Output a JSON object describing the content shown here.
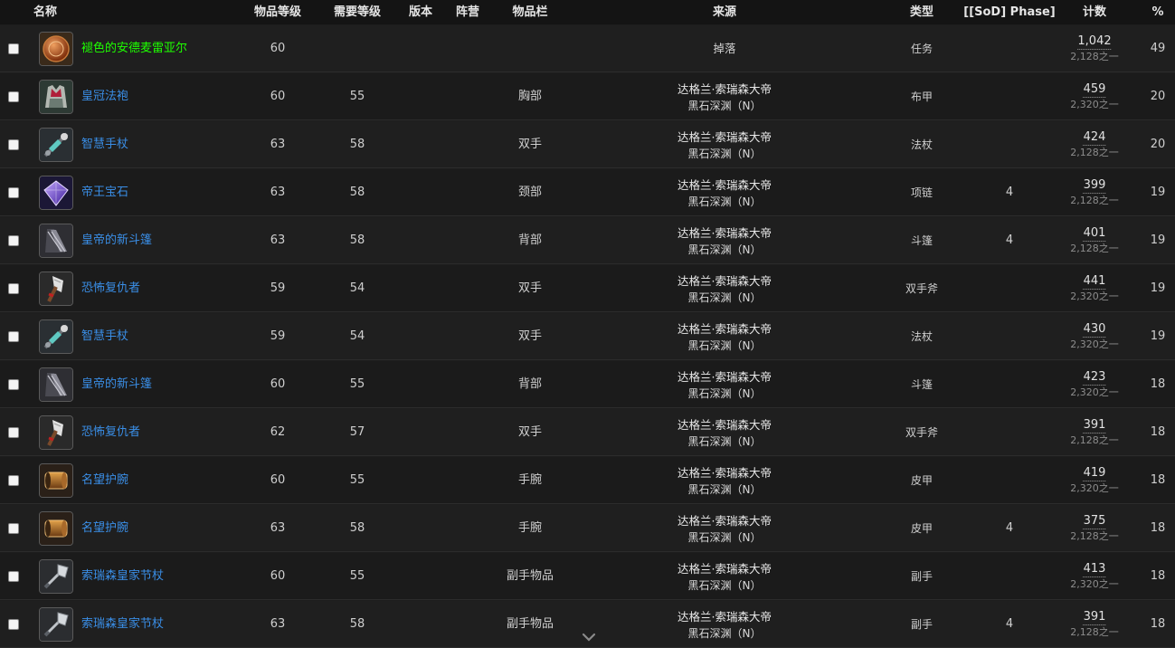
{
  "columns": [
    "名称",
    "物品等级",
    "需要等级",
    "版本",
    "阵营",
    "物品栏",
    "来源",
    "类型",
    "[[SoD] Phase]",
    "计数",
    "%"
  ],
  "rows": [
    {
      "name": "褪色的安德麦雷亚尔",
      "quality": "green",
      "icon": "coin-icon",
      "ilvl": "60",
      "req": "",
      "slot": "",
      "src1": "掉落",
      "src2": "",
      "type": "任务",
      "phase": "",
      "count": "1,042",
      "of": "2,128之一",
      "pct": "49"
    },
    {
      "name": "皇冠法袍",
      "quality": "blue",
      "icon": "robe-icon",
      "ilvl": "60",
      "req": "55",
      "slot": "胸部",
      "src1": "达格兰·索瑞森大帝",
      "src2": "黑石深渊（N）",
      "type": "布甲",
      "phase": "",
      "count": "459",
      "of": "2,320之一",
      "pct": "20"
    },
    {
      "name": "智慧手杖",
      "quality": "blue",
      "icon": "staff-icon",
      "ilvl": "63",
      "req": "58",
      "slot": "双手",
      "src1": "达格兰·索瑞森大帝",
      "src2": "黑石深渊（N）",
      "type": "法杖",
      "phase": "",
      "count": "424",
      "of": "2,128之一",
      "pct": "20"
    },
    {
      "name": "帝王宝石",
      "quality": "blue",
      "icon": "gem-icon",
      "ilvl": "63",
      "req": "58",
      "slot": "颈部",
      "src1": "达格兰·索瑞森大帝",
      "src2": "黑石深渊（N）",
      "type": "项链",
      "phase": "4",
      "count": "399",
      "of": "2,128之一",
      "pct": "19"
    },
    {
      "name": "皇帝的新斗篷",
      "quality": "blue",
      "icon": "cloak-icon",
      "ilvl": "63",
      "req": "58",
      "slot": "背部",
      "src1": "达格兰·索瑞森大帝",
      "src2": "黑石深渊（N）",
      "type": "斗篷",
      "phase": "4",
      "count": "401",
      "of": "2,128之一",
      "pct": "19"
    },
    {
      "name": "恐怖复仇者",
      "quality": "blue",
      "icon": "axe-icon",
      "ilvl": "59",
      "req": "54",
      "slot": "双手",
      "src1": "达格兰·索瑞森大帝",
      "src2": "黑石深渊（N）",
      "type": "双手斧",
      "phase": "",
      "count": "441",
      "of": "2,320之一",
      "pct": "19"
    },
    {
      "name": "智慧手杖",
      "quality": "blue",
      "icon": "staff-icon",
      "ilvl": "59",
      "req": "54",
      "slot": "双手",
      "src1": "达格兰·索瑞森大帝",
      "src2": "黑石深渊（N）",
      "type": "法杖",
      "phase": "",
      "count": "430",
      "of": "2,320之一",
      "pct": "19"
    },
    {
      "name": "皇帝的新斗篷",
      "quality": "blue",
      "icon": "cloak-icon",
      "ilvl": "60",
      "req": "55",
      "slot": "背部",
      "src1": "达格兰·索瑞森大帝",
      "src2": "黑石深渊（N）",
      "type": "斗篷",
      "phase": "",
      "count": "423",
      "of": "2,320之一",
      "pct": "18"
    },
    {
      "name": "恐怖复仇者",
      "quality": "blue",
      "icon": "axe-icon",
      "ilvl": "62",
      "req": "57",
      "slot": "双手",
      "src1": "达格兰·索瑞森大帝",
      "src2": "黑石深渊（N）",
      "type": "双手斧",
      "phase": "",
      "count": "391",
      "of": "2,128之一",
      "pct": "18"
    },
    {
      "name": "名望护腕",
      "quality": "blue",
      "icon": "bracer-icon",
      "ilvl": "60",
      "req": "55",
      "slot": "手腕",
      "src1": "达格兰·索瑞森大帝",
      "src2": "黑石深渊（N）",
      "type": "皮甲",
      "phase": "",
      "count": "419",
      "of": "2,320之一",
      "pct": "18"
    },
    {
      "name": "名望护腕",
      "quality": "blue",
      "icon": "bracer-icon",
      "ilvl": "63",
      "req": "58",
      "slot": "手腕",
      "src1": "达格兰·索瑞森大帝",
      "src2": "黑石深渊（N）",
      "type": "皮甲",
      "phase": "4",
      "count": "375",
      "of": "2,128之一",
      "pct": "18"
    },
    {
      "name": "索瑞森皇家节杖",
      "quality": "blue",
      "icon": "scepter-icon",
      "ilvl": "60",
      "req": "55",
      "slot": "副手物品",
      "src1": "达格兰·索瑞森大帝",
      "src2": "黑石深渊（N）",
      "type": "副手",
      "phase": "",
      "count": "413",
      "of": "2,320之一",
      "pct": "18"
    },
    {
      "name": "索瑞森皇家节杖",
      "quality": "blue",
      "icon": "scepter-icon",
      "ilvl": "63",
      "req": "58",
      "slot": "副手物品",
      "src1": "达格兰·索瑞森大帝",
      "src2": "黑石深渊（N）",
      "type": "副手",
      "phase": "4",
      "count": "391",
      "of": "2,128之一",
      "pct": "18"
    }
  ],
  "colors": {
    "quality_green": "#1eff00",
    "quality_blue": "#3a8ee6",
    "background": "#1d1d1d",
    "header": "#141414"
  },
  "scroll_indicator": "chevron-down-icon"
}
